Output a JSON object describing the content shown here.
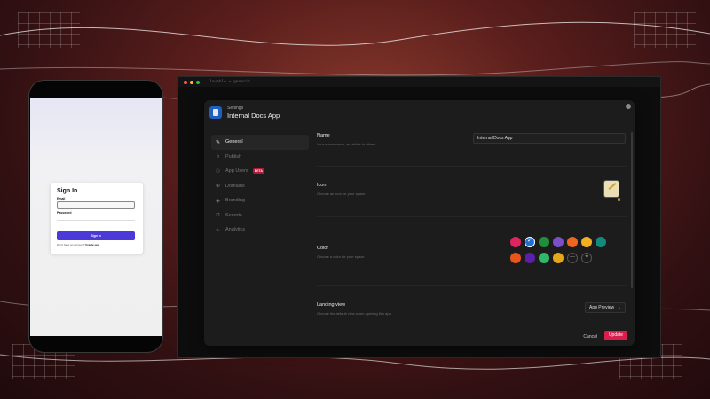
{
  "phone": {
    "signin": {
      "title": "Sign In",
      "email_label": "Email",
      "password_label": "Password",
      "button_label": "Sign In",
      "signup_text": "Don't have an account?",
      "signup_link": "Create one"
    }
  },
  "desktop": {
    "window_path": "lovable → generic"
  },
  "modal": {
    "header_small": "Settings",
    "header_title": "Internal Docs App",
    "nav": [
      {
        "label": "General",
        "icon": "pencil-icon",
        "glyph": "✎"
      },
      {
        "label": "Publish",
        "icon": "lightning-icon",
        "glyph": "ϟ"
      },
      {
        "label": "App Users",
        "icon": "users-icon",
        "glyph": "⚇",
        "badge": "BETA"
      },
      {
        "label": "Domains",
        "icon": "globe-icon",
        "glyph": "⊕"
      },
      {
        "label": "Branding",
        "icon": "palette-icon",
        "glyph": "◈"
      },
      {
        "label": "Secrets",
        "icon": "lock-icon",
        "glyph": "⊓"
      },
      {
        "label": "Analytics",
        "icon": "chart-icon",
        "glyph": "∿"
      }
    ],
    "sections": {
      "name": {
        "title": "Name",
        "desc": "Your space name, as visible to others.",
        "value": "Internal Docs App"
      },
      "icon": {
        "title": "Icon",
        "desc": "Choose an icon for your space."
      },
      "color": {
        "title": "Color",
        "desc": "Choose a color for your space."
      },
      "landing": {
        "title": "Landing view",
        "desc": "Choose the default view when opening this app.",
        "value": "App Preview"
      }
    },
    "colors": [
      "#e0245e",
      "#1f6fd6",
      "#1f8f3a",
      "#7b4fc9",
      "#f0661e",
      "#f2b01e",
      "#138a7e",
      "#e8541a",
      "#5c1fa8",
      "#2fb86a",
      "#e3a81a"
    ],
    "selected_color": "#1f6fd6",
    "cancel_label": "Cancel",
    "update_label": "Update"
  }
}
